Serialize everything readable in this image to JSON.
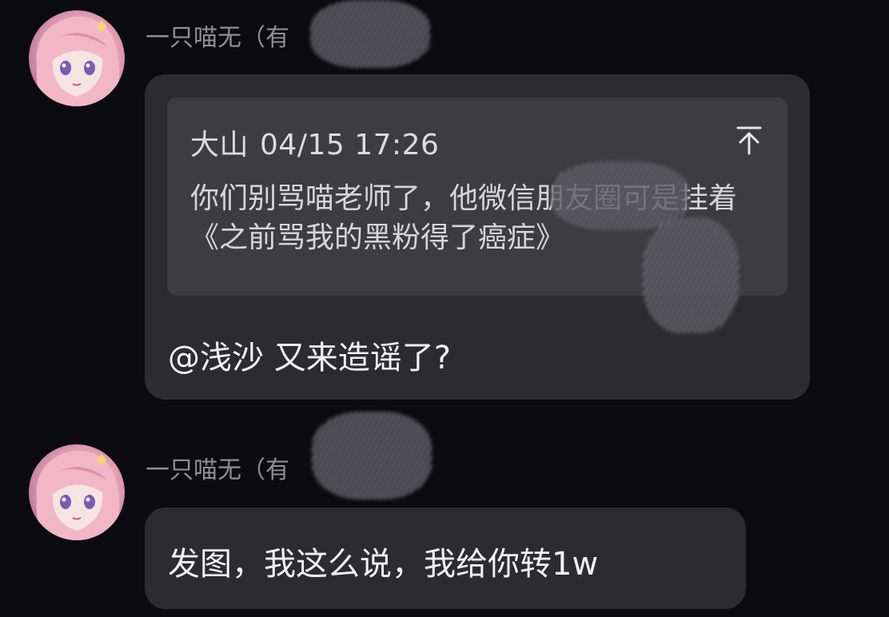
{
  "colors": {
    "background": "#0c0b10",
    "bubble": "#2c2c30",
    "quote_box": "#3c3c41",
    "sender_name": "#8f8e95"
  },
  "messages": [
    {
      "avatar_icon": "anime-avatar-icon",
      "sender": "一只喵无（有",
      "quote": {
        "author": "大山",
        "time": "04/15 17:26",
        "text": "你们别骂喵老师了，他微信朋友圈可是挂着《之前骂我的黑粉得了癌症》",
        "icon": "arrow-up-to-top-icon"
      },
      "text": "@浅沙 又来造谣了?"
    },
    {
      "avatar_icon": "anime-avatar-icon",
      "sender": "一只喵无（有",
      "text": "发图，我这么说，我给你转1w"
    }
  ]
}
